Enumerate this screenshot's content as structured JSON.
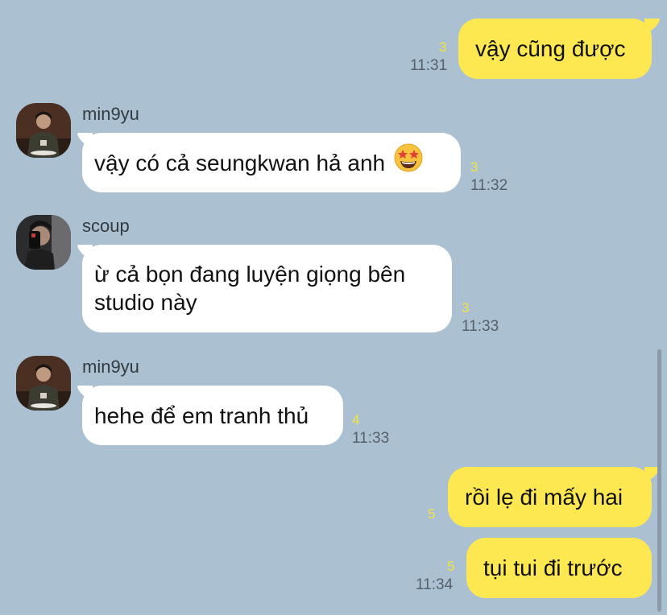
{
  "messages": [
    {
      "from": "me",
      "text": "vậy cũng được",
      "unread": "3",
      "time": "11:31"
    },
    {
      "from": "min9yu",
      "sender": "min9yu",
      "text": "vậy có cả seungkwan hả anh",
      "emoji": "star-struck-emoji",
      "unread": "3",
      "time": "11:32"
    },
    {
      "from": "scoup",
      "sender": "scoup",
      "text": "ừ cả bọn đang luyện giọng bên studio này",
      "unread": "3",
      "time": "11:33"
    },
    {
      "from": "min9yu",
      "sender": "min9yu",
      "text": "hehe để em tranh thủ",
      "unread": "4",
      "time": "11:33"
    },
    {
      "from": "me",
      "text": "rồi lẹ đi mấy hai",
      "unread": "5",
      "time": ""
    },
    {
      "from": "me",
      "text": "tụi tui đi trước",
      "unread": "5",
      "time": "11:34"
    }
  ],
  "colors": {
    "background": "#abc1d1",
    "my_bubble": "#fee851",
    "their_bubble": "#ffffff",
    "unread_count": "#f4e33f",
    "timestamp": "#56606a"
  }
}
